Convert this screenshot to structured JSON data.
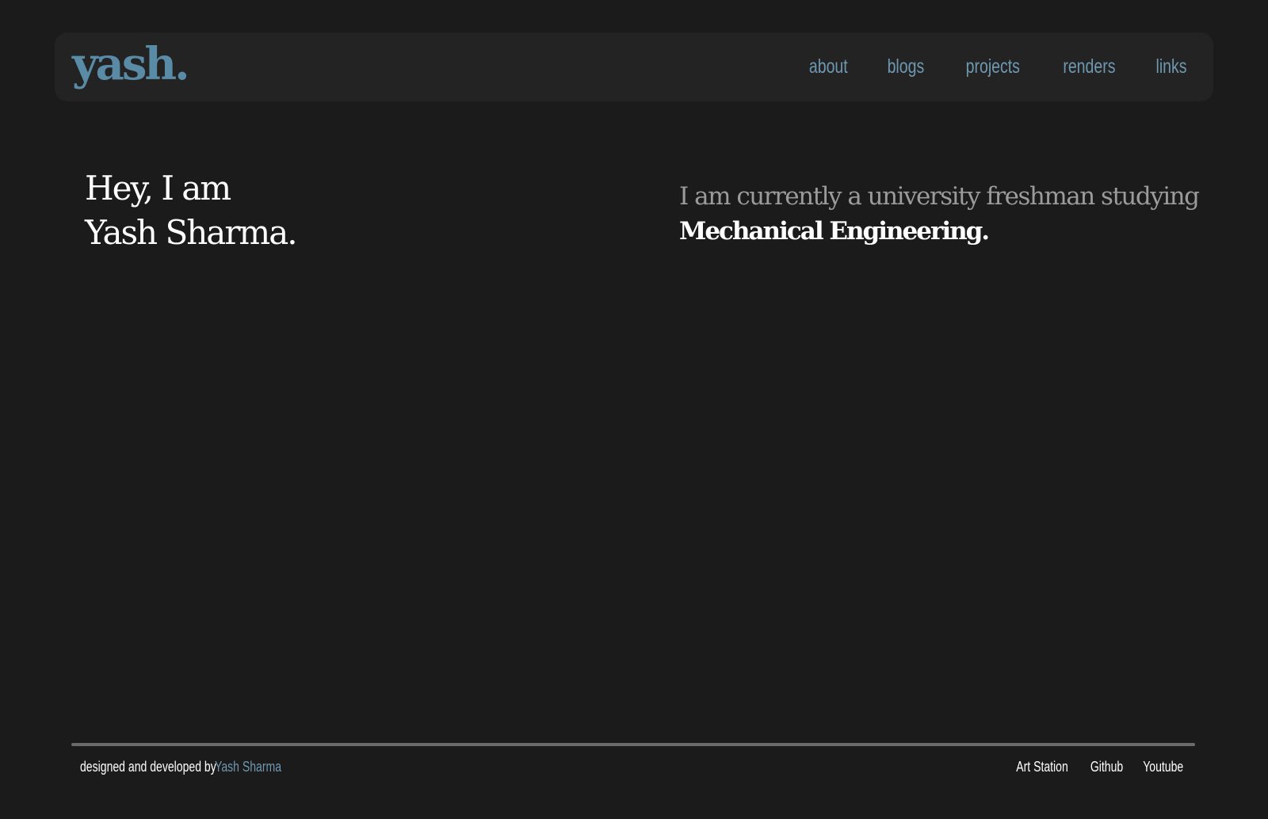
{
  "header": {
    "logo": "yash.",
    "nav": {
      "about": "about",
      "blogs": "blogs",
      "projects": "projects",
      "renders": "renders",
      "links": "links"
    }
  },
  "hero": {
    "greeting_line1": "Hey, I am",
    "greeting_line2": "Yash Sharma.",
    "intro": "I am currently a university freshman studying",
    "field": "Mechanical Engineering."
  },
  "footer": {
    "credit": "designed and developed by",
    "author": "Yash Sharma",
    "links": {
      "artstation": "Art Station",
      "github": "Github",
      "youtube": "Youtube"
    }
  },
  "colors": {
    "background": "#1b1b1b",
    "navbar": "#232323",
    "accent": "#6e98b0",
    "text": "#ffffff",
    "muted_text": "#9b9b9b"
  }
}
